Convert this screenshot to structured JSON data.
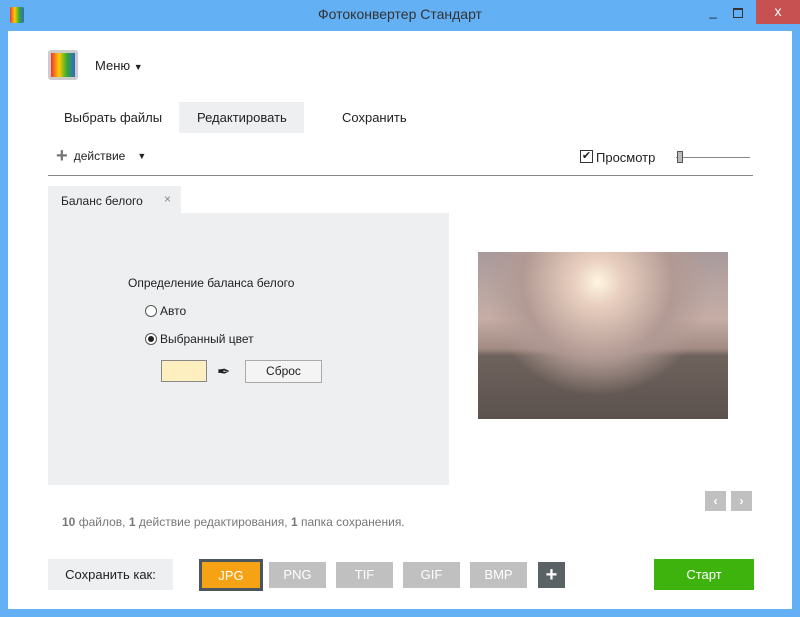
{
  "window": {
    "title": "Фотоконвертер Стандарт",
    "minimize": "_",
    "maximize": "□",
    "close": "x"
  },
  "menu": {
    "label": "Меню"
  },
  "tabs": [
    {
      "label": "Выбрать файлы"
    },
    {
      "label": "Редактировать"
    },
    {
      "label": "Сохранить"
    }
  ],
  "toolbar": {
    "action_label": "действие",
    "preview_label": "Просмотр",
    "preview_checked": true,
    "zoom_level": 0
  },
  "panel": {
    "tab_label": "Баланс белого",
    "close": "×",
    "heading": "Определение баланса белого",
    "auto": "Авто",
    "selected_color": "Выбранный цвет",
    "swatch_color": "#fdefc0",
    "reset": "Сброс"
  },
  "status": {
    "files_count": "10",
    "files_text": "файлов,",
    "actions_count": "1",
    "actions_text": "действие редактирования,",
    "folders_count": "1",
    "folders_text": "папка сохранения."
  },
  "save": {
    "label": "Сохранить как:",
    "formats": [
      "JPG",
      "PNG",
      "TIF",
      "GIF",
      "BMP"
    ],
    "selected": "JPG",
    "add": "+",
    "start": "Старт"
  },
  "colors": {
    "accent": "#f5a314",
    "start": "#3eb30e",
    "titlebar": "#63b0f5",
    "close": "#c75050"
  }
}
